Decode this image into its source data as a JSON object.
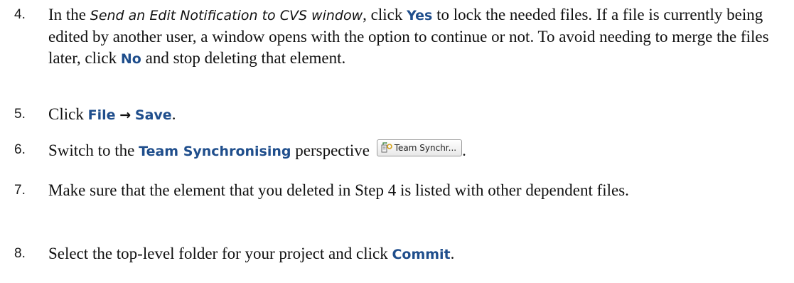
{
  "steps": [
    {
      "number": "4.",
      "pre": "In the ",
      "window_name": "Send an Edit Notification to CVS window",
      "mid1": ", click ",
      "yes": "Yes",
      "mid2": " to lock the needed files. If a file is currently being edited by another user, a window opens with the option to continue or not.  To avoid needing to merge the files later, click ",
      "no": "No",
      "post": " and stop deleting that element."
    },
    {
      "number": "5.",
      "pre": "Click ",
      "file": "File",
      "arrow": "→",
      "save": "Save",
      "post": "."
    },
    {
      "number": "6.",
      "pre": "Switch to the ",
      "perspective": "Team Synchronising",
      "mid": " perspective",
      "button_label": "Team Synchr...",
      "button_icon": "team-synchronize-icon",
      "post": "."
    },
    {
      "number": "7.",
      "text": "Make sure that the element that you deleted in Step 4 is listed with other dependent files."
    },
    {
      "number": "8.",
      "pre": "Select the top-level folder for your project and click ",
      "commit": "Commit",
      "post": "."
    }
  ]
}
